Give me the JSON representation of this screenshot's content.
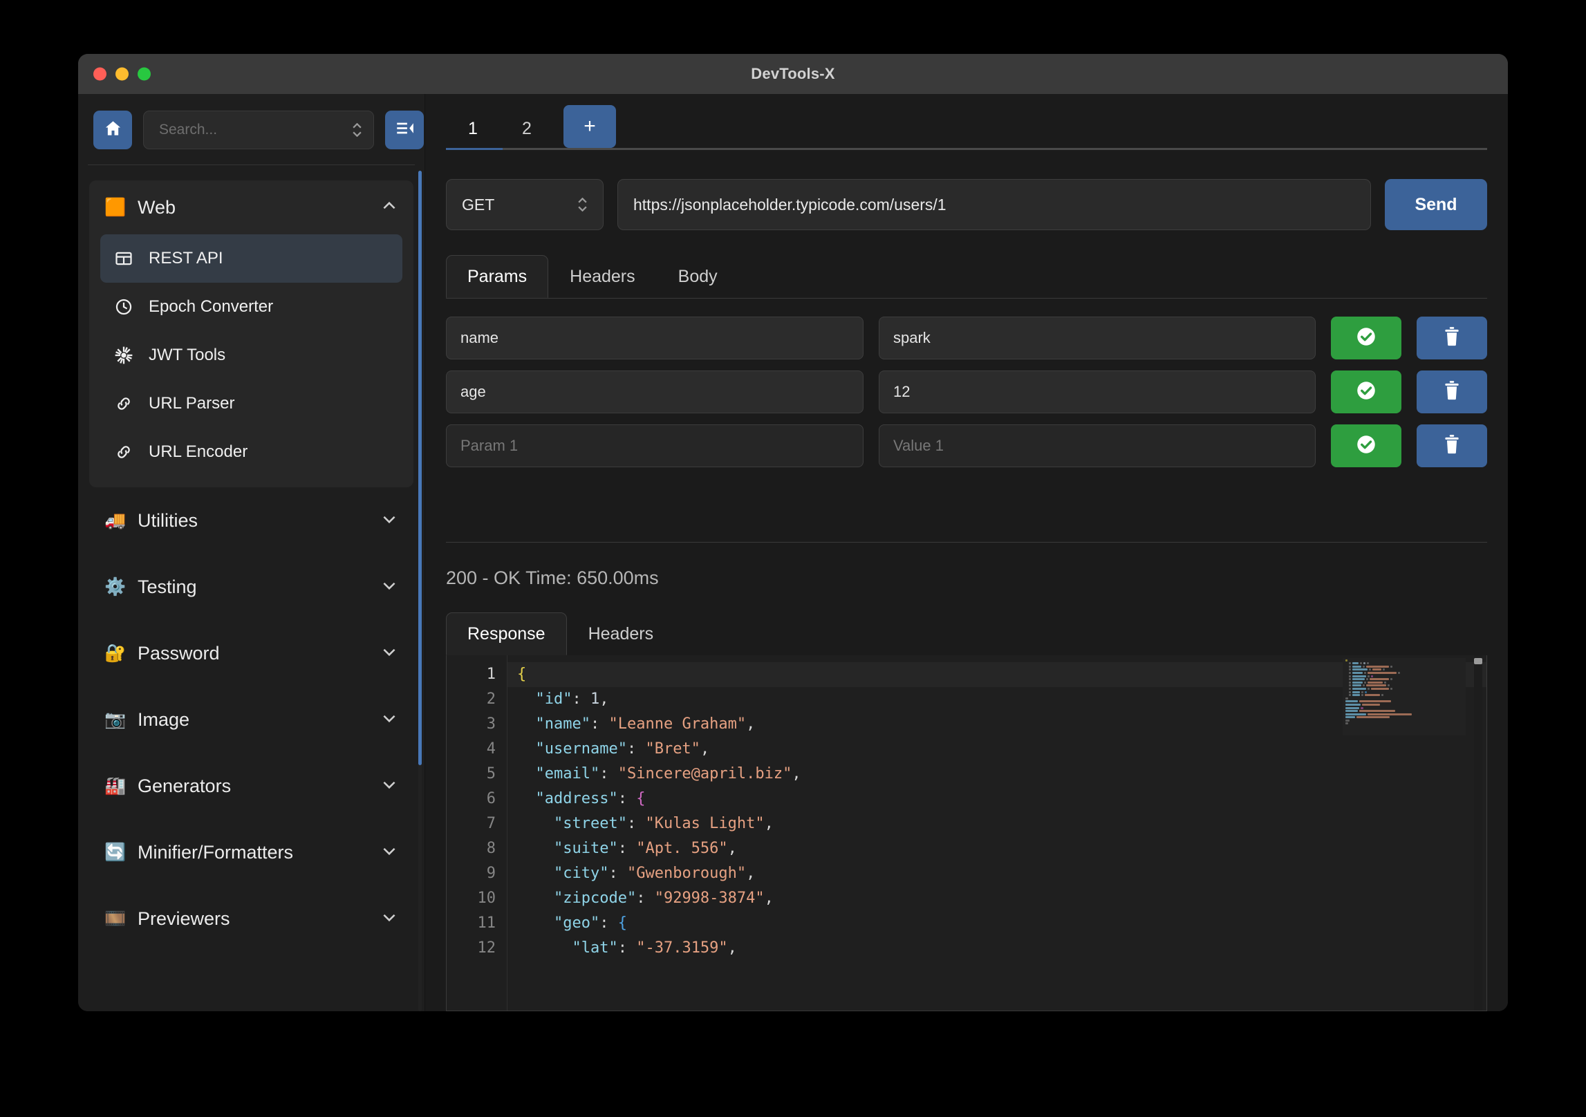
{
  "window": {
    "title": "DevTools-X",
    "controls": [
      "close",
      "minimize",
      "maximize"
    ]
  },
  "sidebar": {
    "home_icon": "home-icon",
    "collapse_icon": "collapse-sidebar-icon",
    "search": {
      "value": "",
      "placeholder": "Search..."
    },
    "web_group": {
      "label": "Web",
      "glyph": "🟧",
      "expanded": true,
      "items": [
        {
          "label": "REST API",
          "icon": "rest-api-icon",
          "active": true
        },
        {
          "label": "Epoch Converter",
          "icon": "clock-icon",
          "active": false
        },
        {
          "label": "JWT Tools",
          "icon": "jwt-icon",
          "active": false
        },
        {
          "label": "URL Parser",
          "icon": "link-icon",
          "active": false
        },
        {
          "label": "URL Encoder",
          "icon": "link-icon",
          "active": false
        }
      ]
    },
    "groups": [
      {
        "label": "Utilities",
        "glyph": "🚚",
        "expanded": false
      },
      {
        "label": "Testing",
        "glyph": "⚙️",
        "expanded": false
      },
      {
        "label": "Password",
        "glyph": "🔐",
        "expanded": false
      },
      {
        "label": "Image",
        "glyph": "📷",
        "expanded": false
      },
      {
        "label": "Generators",
        "glyph": "🏭",
        "expanded": false
      },
      {
        "label": "Minifier/Formatters",
        "glyph": "🔄",
        "expanded": false
      },
      {
        "label": "Previewers",
        "glyph": "🎞️",
        "expanded": false
      }
    ]
  },
  "main": {
    "request_tabs": [
      {
        "label": "1",
        "active": true
      },
      {
        "label": "2",
        "active": false
      }
    ],
    "add_tab_label": "+",
    "method": {
      "selected": "GET"
    },
    "url": {
      "value": "https://jsonplaceholder.typicode.com/users/1",
      "placeholder": ""
    },
    "send_label": "Send",
    "request_subtabs": [
      {
        "label": "Params",
        "active": true
      },
      {
        "label": "Headers",
        "active": false
      },
      {
        "label": "Body",
        "active": false
      }
    ],
    "params": [
      {
        "key": "name",
        "value": "spark",
        "key_placeholder": "",
        "value_placeholder": "",
        "empty": false
      },
      {
        "key": "age",
        "value": "12",
        "key_placeholder": "",
        "value_placeholder": "",
        "empty": false
      },
      {
        "key": "",
        "value": "",
        "key_placeholder": "Param 1",
        "value_placeholder": "Value 1",
        "empty": true
      }
    ],
    "status_text": "200 - OK Time: 650.00ms",
    "response_subtabs": [
      {
        "label": "Response",
        "active": true
      },
      {
        "label": "Headers",
        "active": false
      }
    ],
    "response_lines": [
      {
        "n": "1",
        "tokens": [
          {
            "t": "{",
            "c": "brace-y"
          }
        ]
      },
      {
        "n": "2",
        "tokens": [
          {
            "t": "  ",
            "c": "p"
          },
          {
            "t": "\"id\"",
            "c": "key"
          },
          {
            "t": ": ",
            "c": "p"
          },
          {
            "t": "1",
            "c": "num"
          },
          {
            "t": ",",
            "c": "p"
          }
        ]
      },
      {
        "n": "3",
        "tokens": [
          {
            "t": "  ",
            "c": "p"
          },
          {
            "t": "\"name\"",
            "c": "key"
          },
          {
            "t": ": ",
            "c": "p"
          },
          {
            "t": "\"Leanne Graham\"",
            "c": "str"
          },
          {
            "t": ",",
            "c": "p"
          }
        ]
      },
      {
        "n": "4",
        "tokens": [
          {
            "t": "  ",
            "c": "p"
          },
          {
            "t": "\"username\"",
            "c": "key"
          },
          {
            "t": ": ",
            "c": "p"
          },
          {
            "t": "\"Bret\"",
            "c": "str"
          },
          {
            "t": ",",
            "c": "p"
          }
        ]
      },
      {
        "n": "5",
        "tokens": [
          {
            "t": "  ",
            "c": "p"
          },
          {
            "t": "\"email\"",
            "c": "key"
          },
          {
            "t": ": ",
            "c": "p"
          },
          {
            "t": "\"Sincere@april.biz\"",
            "c": "str"
          },
          {
            "t": ",",
            "c": "p"
          }
        ]
      },
      {
        "n": "6",
        "tokens": [
          {
            "t": "  ",
            "c": "p"
          },
          {
            "t": "\"address\"",
            "c": "key"
          },
          {
            "t": ": ",
            "c": "p"
          },
          {
            "t": "{",
            "c": "brace-m"
          }
        ]
      },
      {
        "n": "7",
        "tokens": [
          {
            "t": "    ",
            "c": "p"
          },
          {
            "t": "\"street\"",
            "c": "key"
          },
          {
            "t": ": ",
            "c": "p"
          },
          {
            "t": "\"Kulas Light\"",
            "c": "str"
          },
          {
            "t": ",",
            "c": "p"
          }
        ]
      },
      {
        "n": "8",
        "tokens": [
          {
            "t": "    ",
            "c": "p"
          },
          {
            "t": "\"suite\"",
            "c": "key"
          },
          {
            "t": ": ",
            "c": "p"
          },
          {
            "t": "\"Apt. 556\"",
            "c": "str"
          },
          {
            "t": ",",
            "c": "p"
          }
        ]
      },
      {
        "n": "9",
        "tokens": [
          {
            "t": "    ",
            "c": "p"
          },
          {
            "t": "\"city\"",
            "c": "key"
          },
          {
            "t": ": ",
            "c": "p"
          },
          {
            "t": "\"Gwenborough\"",
            "c": "str"
          },
          {
            "t": ",",
            "c": "p"
          }
        ]
      },
      {
        "n": "10",
        "tokens": [
          {
            "t": "    ",
            "c": "p"
          },
          {
            "t": "\"zipcode\"",
            "c": "key"
          },
          {
            "t": ": ",
            "c": "p"
          },
          {
            "t": "\"92998-3874\"",
            "c": "str"
          },
          {
            "t": ",",
            "c": "p"
          }
        ]
      },
      {
        "n": "11",
        "tokens": [
          {
            "t": "    ",
            "c": "p"
          },
          {
            "t": "\"geo\"",
            "c": "key"
          },
          {
            "t": ": ",
            "c": "p"
          },
          {
            "t": "{",
            "c": "brace-b"
          }
        ]
      },
      {
        "n": "12",
        "tokens": [
          {
            "t": "      ",
            "c": "p"
          },
          {
            "t": "\"lat\"",
            "c": "key"
          },
          {
            "t": ": ",
            "c": "p"
          },
          {
            "t": "\"-37.3159\"",
            "c": "str"
          },
          {
            "t": ",",
            "c": "p"
          }
        ]
      }
    ],
    "row_actions": {
      "confirm_icon": "check-circle-icon",
      "delete_icon": "trash-icon"
    }
  },
  "colors": {
    "accent_blue": "#3c6399",
    "confirm_green": "#2e9e3f",
    "scrollbar_blue": "#4878b8",
    "window_bg": "#1e1e1e",
    "panel_bg": "#1b1b1b"
  }
}
